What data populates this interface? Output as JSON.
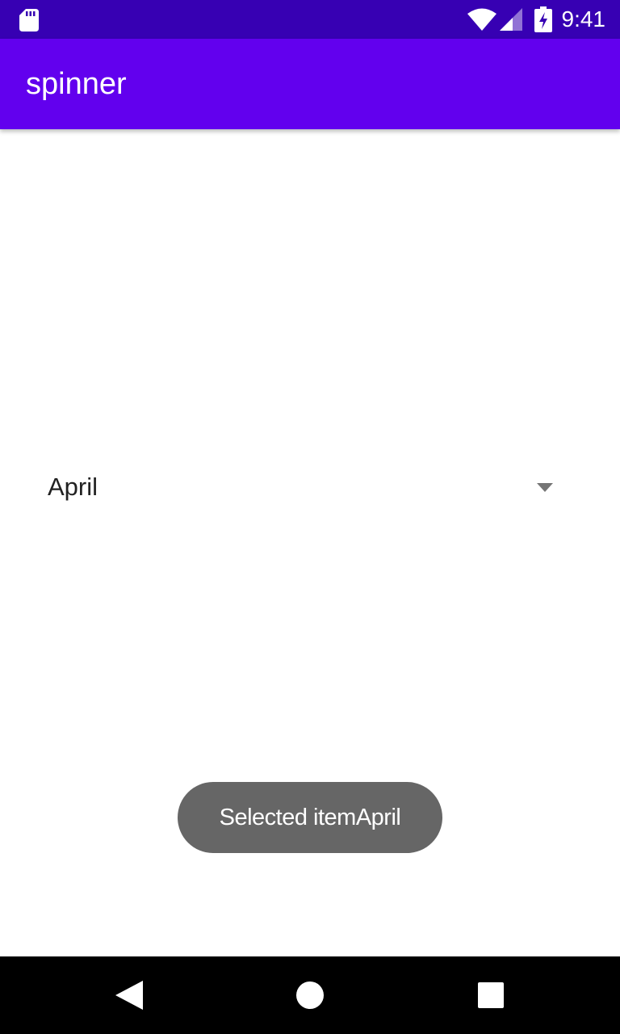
{
  "status_bar": {
    "time": "9:41",
    "background_color": "#3700b3",
    "icons": [
      "sd-card-icon",
      "wifi-icon",
      "cell-signal-icon",
      "battery-charging-icon"
    ]
  },
  "app_bar": {
    "title": "spinner",
    "background_color": "#6200ee"
  },
  "spinner": {
    "selected_value": "April",
    "icon": "dropdown-arrow-icon"
  },
  "toast": {
    "message": "Selected itemApril",
    "background_color": "#666666"
  },
  "nav_bar": {
    "background_color": "#000000",
    "icons": [
      "back-icon",
      "home-icon",
      "recents-icon"
    ]
  }
}
